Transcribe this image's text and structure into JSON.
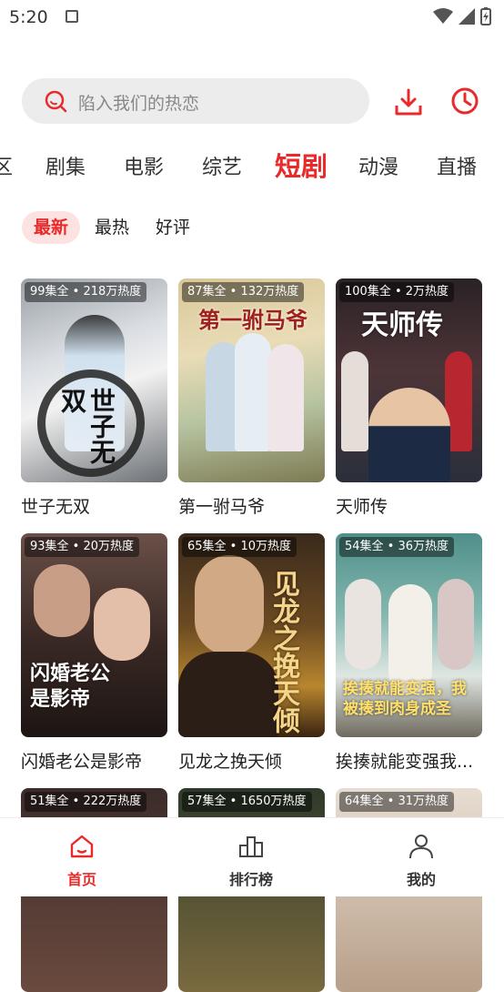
{
  "status": {
    "time": "5:20"
  },
  "search": {
    "placeholder": "陷入我们的热恋"
  },
  "categories": [
    {
      "label": "区"
    },
    {
      "label": "剧集"
    },
    {
      "label": "电影"
    },
    {
      "label": "综艺"
    },
    {
      "label": "短剧"
    },
    {
      "label": "动漫"
    },
    {
      "label": "直播"
    }
  ],
  "active_category": "短剧",
  "subtabs": [
    {
      "label": "最新"
    },
    {
      "label": "最热"
    },
    {
      "label": "好评"
    }
  ],
  "active_subtab": "最新",
  "dramas": [
    {
      "badge": "99集全 • 218万热度",
      "title": "世子无双",
      "poster_text": "世子无双"
    },
    {
      "badge": "87集全 • 132万热度",
      "title": "第一驸马爷",
      "poster_text": "第一驸马爷"
    },
    {
      "badge": "100集全 • 2万热度",
      "title": "天师传",
      "poster_text": "天师传"
    },
    {
      "badge": "93集全 • 20万热度",
      "title": "闪婚老公是影帝",
      "poster_text": "闪婚老公是影帝"
    },
    {
      "badge": "65集全 • 10万热度",
      "title": "见龙之挽天倾",
      "poster_text": "见龙之挽天倾"
    },
    {
      "badge": "54集全 • 36万热度",
      "title": "挨揍就能变强我...",
      "poster_text": "挨揍就能变强，我被揍到肉身成圣"
    },
    {
      "badge": "51集全 • 222万热度",
      "title": "",
      "poster_text": ""
    },
    {
      "badge": "57集全 • 1650万热度",
      "title": "",
      "poster_text": ""
    },
    {
      "badge": "64集全 • 31万热度",
      "title": "",
      "poster_text": ""
    }
  ],
  "nav": [
    {
      "label": "首页",
      "icon": "home-icon"
    },
    {
      "label": "排行榜",
      "icon": "ranking-icon"
    },
    {
      "label": "我的",
      "icon": "profile-icon"
    }
  ],
  "colors": {
    "accent": "#e82a2a",
    "search_bg": "#ececec",
    "subtab_active_bg": "#fde2e2"
  }
}
